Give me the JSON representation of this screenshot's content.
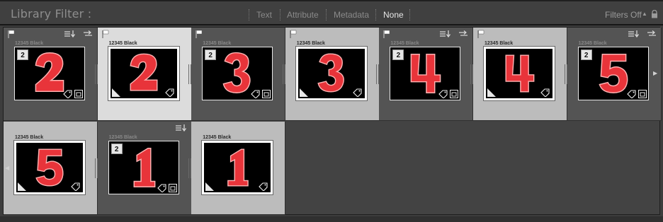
{
  "filter_bar": {
    "title": "Library Filter :",
    "options": [
      "Text",
      "Attribute",
      "Metadata",
      "None"
    ],
    "active": "None",
    "filters_status": "Filters Off",
    "filters_caret": "▲"
  },
  "colors": {
    "accent_number": "#e8343a",
    "active_text": "#e6e6e6"
  },
  "cells": [
    {
      "name": "12345 Black",
      "digit": "2",
      "badge": "2",
      "style": "dark",
      "flag": true,
      "sort": true,
      "rotate": true
    },
    {
      "name": "12345 Black",
      "digit": "2",
      "badge": "",
      "style": "light",
      "flag": true,
      "sort": false,
      "rotate": false
    },
    {
      "name": "12345 Black",
      "digit": "3",
      "badge": "2",
      "style": "dark",
      "flag": true,
      "sort": false,
      "rotate": false
    },
    {
      "name": "12345 Black",
      "digit": "3",
      "badge": "",
      "style": "mid",
      "flag": true,
      "sort": false,
      "rotate": false
    },
    {
      "name": "12345 Black",
      "digit": "4",
      "badge": "2",
      "style": "dark",
      "flag": true,
      "sort": true,
      "rotate": true
    },
    {
      "name": "12345 Black",
      "digit": "4",
      "badge": "",
      "style": "mid",
      "flag": true,
      "sort": false,
      "rotate": false
    },
    {
      "name": "12345 Black",
      "digit": "5",
      "badge": "2",
      "style": "dark",
      "flag": false,
      "sort": true,
      "rotate": true
    },
    {
      "name": "12345 Black",
      "digit": "5",
      "badge": "",
      "style": "mid",
      "flag": false,
      "sort": false,
      "rotate": false
    },
    {
      "name": "12345 Black",
      "digit": "1",
      "badge": "2",
      "style": "dark",
      "flag": false,
      "sort": true,
      "rotate": false
    },
    {
      "name": "12345 Black",
      "digit": "1",
      "badge": "",
      "style": "mid",
      "flag": false,
      "sort": false,
      "rotate": false
    }
  ],
  "icons": {
    "flag": "flag-icon",
    "sort": "sort-icon",
    "rotate": "rotate-icon",
    "corner": "virtual-copy-corner-icon",
    "tag": "keyword-tag-icon",
    "stack": "stack-icon",
    "lock": "lock-icon"
  }
}
